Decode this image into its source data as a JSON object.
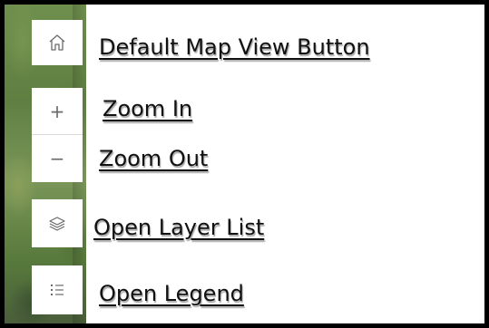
{
  "controls": {
    "home": {
      "icon": "home-icon",
      "label": "Default Map View Button"
    },
    "zoom_in": {
      "icon": "plus-icon",
      "glyph": "+",
      "label": "Zoom In"
    },
    "zoom_out": {
      "icon": "minus-icon",
      "glyph": "−",
      "label": "Zoom Out"
    },
    "layers": {
      "icon": "layers-icon",
      "label": "Open Layer List"
    },
    "legend": {
      "icon": "legend-list-icon",
      "label": "Open Legend"
    }
  },
  "colors": {
    "frame_border": "#000000",
    "icon": "#6b6b6b",
    "label_text": "#111111",
    "map_green": "#6f8f4e"
  }
}
